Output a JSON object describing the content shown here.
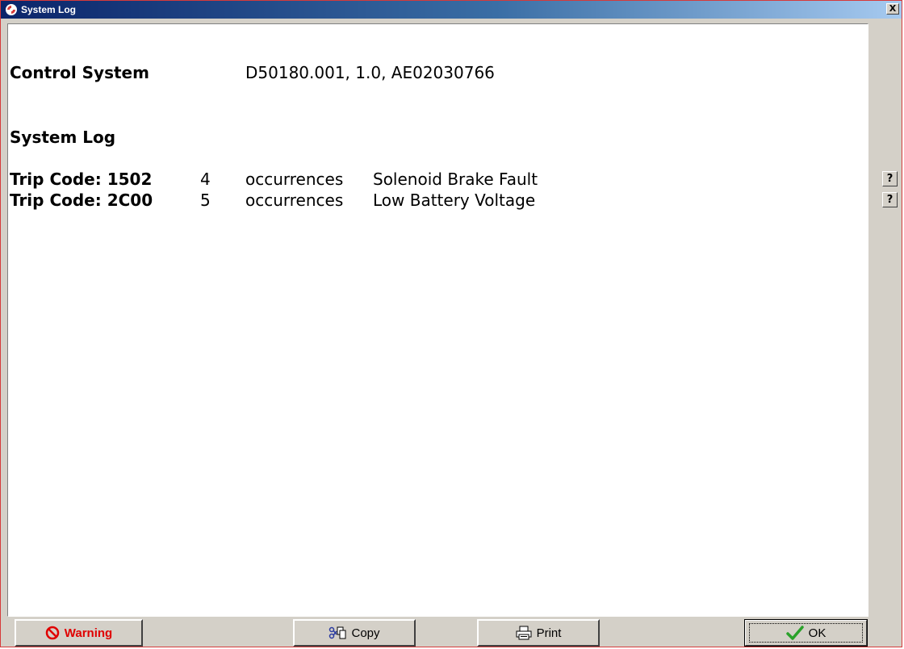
{
  "window": {
    "title": "System Log",
    "close_glyph": "X"
  },
  "log": {
    "control_system_label": "Control System",
    "control_system_value": "D50180.001, 1.0, AE02030766",
    "section_title": "System Log",
    "entries": [
      {
        "code_label": "Trip Code: 1502",
        "count": "4",
        "unit": "occurrences",
        "description": "Solenoid Brake Fault"
      },
      {
        "code_label": "Trip Code: 2C00",
        "count": "5",
        "unit": "occurrences",
        "description": "Low Battery Voltage"
      }
    ]
  },
  "side_help": [
    "?",
    "?"
  ],
  "buttons": {
    "warning": "Warning",
    "copy": "Copy",
    "print": "Print",
    "ok": "OK"
  },
  "colors": {
    "warning_text": "#e00000",
    "ok_check": "#2aa12a",
    "title_gradient_start": "#0a246a",
    "title_gradient_end": "#a6caf0"
  },
  "icons": {
    "app": "app-logo-icon",
    "warning": "prohibited-icon",
    "copy": "copy-icon",
    "print": "printer-icon",
    "ok": "checkmark-icon"
  }
}
